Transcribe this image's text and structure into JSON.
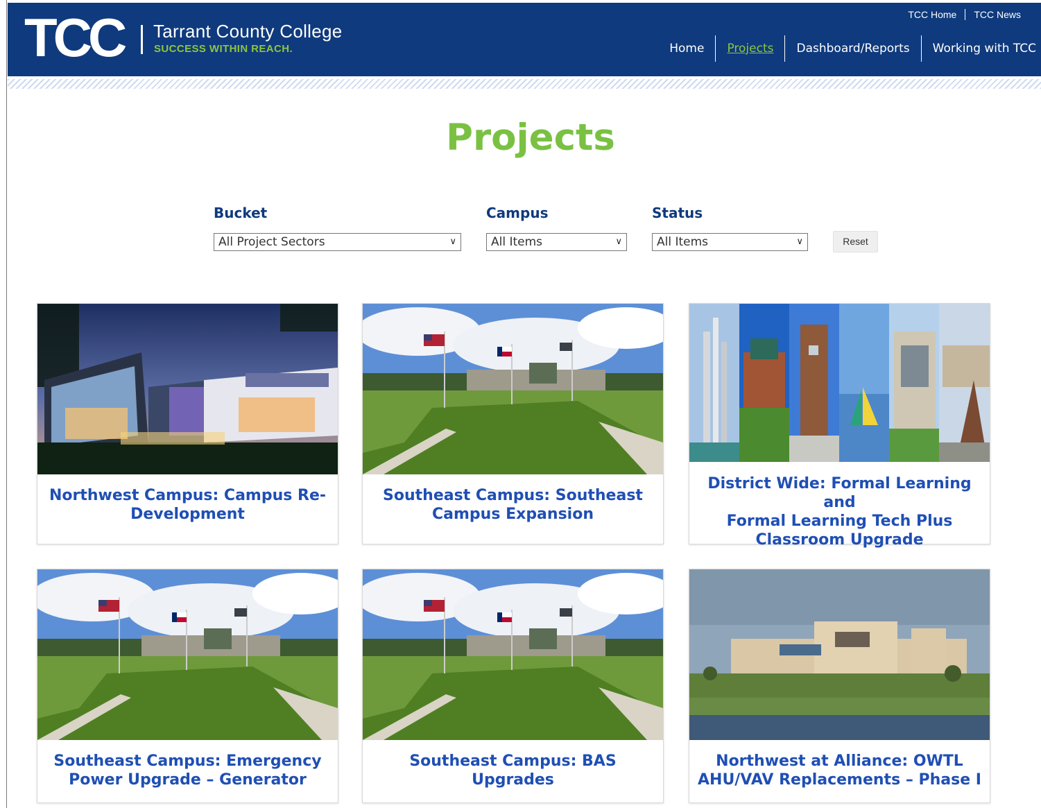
{
  "header": {
    "logo_mark": "TCC",
    "logo_name": "Tarrant County College",
    "logo_tagline": "SUCCESS WITHIN REACH.",
    "utility_links": [
      "TCC Home",
      "TCC News"
    ],
    "nav": [
      {
        "label": "Home",
        "active": false
      },
      {
        "label": "Projects",
        "active": true
      },
      {
        "label": "Dashboard/Reports",
        "active": false
      },
      {
        "label": "Working with TCC",
        "active": false
      }
    ],
    "colors": {
      "brand_blue": "#0f3a7d",
      "brand_green": "#8cc63f"
    }
  },
  "page": {
    "title": "Projects"
  },
  "filters": {
    "bucket": {
      "label": "Bucket",
      "value": "All Project Sectors"
    },
    "campus": {
      "label": "Campus",
      "value": "All Items"
    },
    "status": {
      "label": "Status",
      "value": "All Items"
    },
    "reset_label": "Reset"
  },
  "projects": [
    {
      "title_lines": [
        "Northwest Campus: Campus Re-",
        "Development"
      ],
      "image": "northwest-campus-rendering"
    },
    {
      "title_lines": [
        "Southeast Campus: Southeast",
        "Campus Expansion"
      ],
      "image": "southeast-campus-flags"
    },
    {
      "title_lines": [
        "District Wide: Formal Learning and",
        "Formal Learning Tech Plus",
        "Classroom Upgrade"
      ],
      "image": "district-collage"
    },
    {
      "title_lines": [
        "Southeast Campus: Emergency",
        "Power Upgrade – Generator"
      ],
      "image": "southeast-campus-flags"
    },
    {
      "title_lines": [
        "Southeast Campus: BAS Upgrades"
      ],
      "image": "southeast-campus-flags"
    },
    {
      "title_lines": [
        "Northwest at Alliance: OWTL",
        "AHU/VAV Replacements – Phase I"
      ],
      "image": "northwest-alliance-building"
    }
  ]
}
